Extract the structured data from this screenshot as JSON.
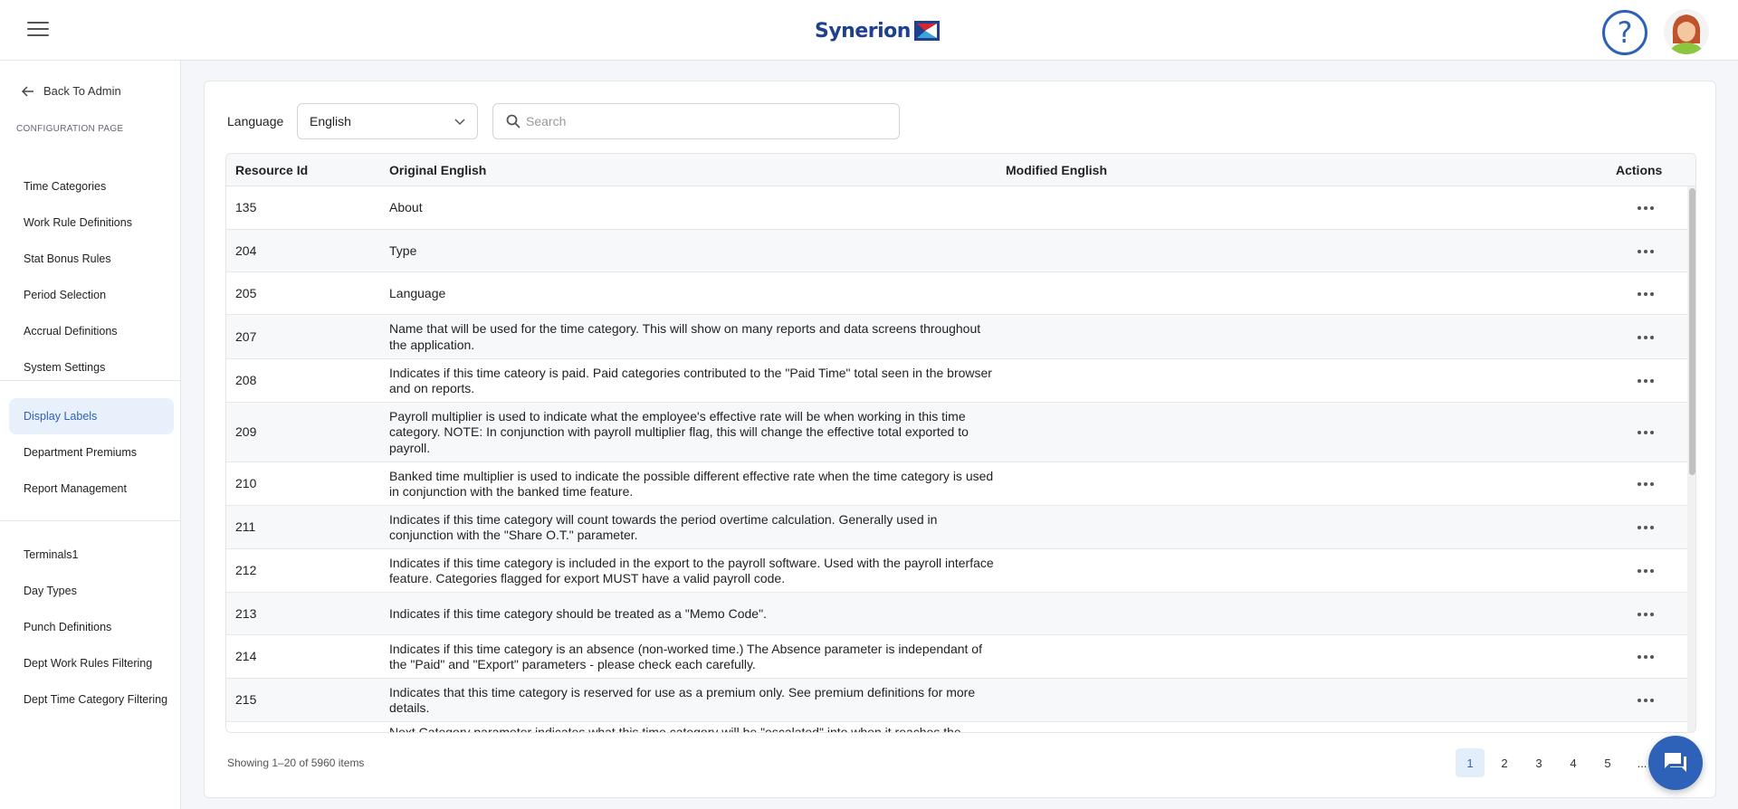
{
  "header": {
    "logo_text": "Synerion",
    "help_icon_glyph": "?"
  },
  "sidebar": {
    "back_label": "Back To Admin",
    "section_label": "CONFIGURATION PAGE",
    "group1": [
      {
        "label": "Time Categories"
      },
      {
        "label": "Work Rule Definitions"
      },
      {
        "label": "Stat Bonus Rules"
      },
      {
        "label": "Period Selection"
      },
      {
        "label": "Accrual Definitions"
      },
      {
        "label": "System Settings"
      }
    ],
    "group2": [
      {
        "label": "Display Labels",
        "active": true
      },
      {
        "label": "Department Premiums"
      },
      {
        "label": "Report Management"
      }
    ],
    "group3": [
      {
        "label": "Terminals1"
      },
      {
        "label": "Day Types"
      },
      {
        "label": "Punch Definitions"
      },
      {
        "label": "Dept Work Rules Filtering"
      },
      {
        "label": "Dept Time Category Filtering"
      }
    ]
  },
  "filters": {
    "language_label": "Language",
    "language_value": "English",
    "search_placeholder": "Search"
  },
  "table": {
    "columns": [
      "Resource Id",
      "Original English",
      "Modified English",
      "Actions"
    ],
    "rows": [
      {
        "id": "135",
        "original": "About",
        "modified": ""
      },
      {
        "id": "204",
        "original": "Type",
        "modified": ""
      },
      {
        "id": "205",
        "original": "Language",
        "modified": ""
      },
      {
        "id": "207",
        "original": "Name that will be used for the time category. This will show on many reports and data screens throughout the application.",
        "modified": ""
      },
      {
        "id": "208",
        "original": "Indicates if this time cateory is paid. Paid categories contributed to the \"Paid Time\" total seen in the browser and on reports.",
        "modified": ""
      },
      {
        "id": "209",
        "original": "Payroll multiplier is used to indicate what the employee's effective rate will be when working in this time category. NOTE: In conjunction with payroll multiplier flag, this will change the effective total exported to payroll.",
        "modified": ""
      },
      {
        "id": "210",
        "original": "Banked time multiplier is used to indicate the possible different effective rate when the time category is used in conjunction with the banked time feature.",
        "modified": ""
      },
      {
        "id": "211",
        "original": "Indicates if this time category will count towards the period overtime calculation. Generally used in conjunction with the \"Share O.T.\" parameter.",
        "modified": ""
      },
      {
        "id": "212",
        "original": "Indicates if this time category is included in the export to the payroll software. Used with the payroll interface feature. Categories flagged for export MUST have a valid payroll code.",
        "modified": ""
      },
      {
        "id": "213",
        "original": "Indicates if this time category should be treated as a \"Memo Code\".",
        "modified": ""
      },
      {
        "id": "214",
        "original": "Indicates if this time category is an absence (non-worked time.) The Absence parameter is independant of the \"Paid\" and \"Export\" parameters - please check each carefully.",
        "modified": ""
      },
      {
        "id": "215",
        "original": "Indicates that this time category is reserved for use as a premium only. See premium definitions for more details.",
        "modified": ""
      },
      {
        "id": "",
        "original": "Next Category parameter indicates what this time category will be \"escalated\" into when it reaches the",
        "modified": ""
      }
    ]
  },
  "footer": {
    "showing_text": "Showing 1–20 of 5960 items",
    "pages": [
      "1",
      "2",
      "3",
      "4",
      "5",
      "..."
    ],
    "active_page": "1"
  },
  "colors": {
    "brand_blue": "#2d62b8",
    "logo_red": "#d8262e",
    "active_bg": "#e8f1fb"
  }
}
